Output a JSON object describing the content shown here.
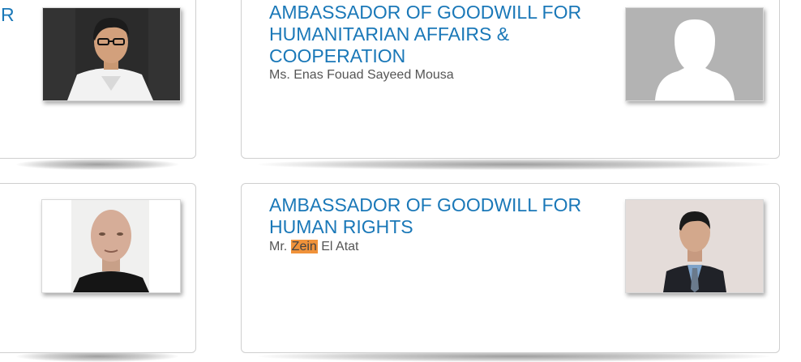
{
  "cards": [
    {
      "title_fragment": "R",
      "photo": "man-glasses-white-shirt-photo"
    },
    {
      "title_lines": [
        "AMBASSADOR OF GOODWILL FOR",
        "HUMANITARIAN AFFAIRS &",
        "COOPERATION"
      ],
      "name": "Ms. Enas Fouad Sayeed Mousa",
      "photo": "default-avatar-silhouette"
    },
    {
      "photo": "bald-man-portrait-photo"
    },
    {
      "title_lines": [
        "AMBASSADOR OF GOODWILL FOR",
        "HUMAN RIGHTS"
      ],
      "name_prefix": "Mr.",
      "name_highlight": "Zein",
      "name_suffix": "El Atat",
      "photo": "man-suit-tie-portrait-photo"
    }
  ],
  "colors": {
    "title": "#1a78b8",
    "name": "#555555",
    "highlight": "#f0923a",
    "card_border": "#cfcfcf"
  }
}
